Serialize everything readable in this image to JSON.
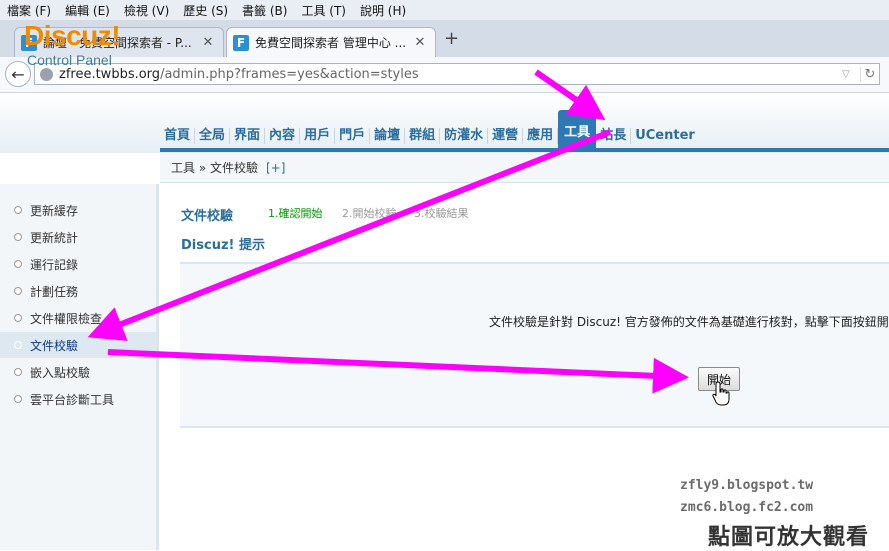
{
  "menubar": [
    "檔案 (F)",
    "編輯 (E)",
    "檢視 (V)",
    "歷史 (S)",
    "書籤 (B)",
    "工具 (T)",
    "說明 (H)"
  ],
  "tabs": [
    {
      "favicon": "F",
      "title": "論壇 - 免費空間探索者 - P..."
    },
    {
      "favicon": "F",
      "title": "免費空間探索者 管理中心 ..."
    }
  ],
  "new_tab": "+",
  "address": {
    "domain": "zfree.twbbs.org",
    "prefix": "",
    "path": "/admin.php?frames=yes&action=styles"
  },
  "logo": {
    "main": "Discuz!",
    "sub": "Control Panel"
  },
  "topnav": [
    "首頁",
    "全局",
    "界面",
    "內容",
    "用戶",
    "門戶",
    "論壇",
    "群組",
    "防灌水",
    "運營",
    "應用",
    "工具",
    "站長",
    "UCenter"
  ],
  "topnav_active": "工具",
  "breadcrumb": {
    "path": "工具 » 文件校驗",
    "add": "[+]"
  },
  "sidebar": [
    {
      "label": "更新緩存"
    },
    {
      "label": "更新統計"
    },
    {
      "label": "運行記錄"
    },
    {
      "label": "計劃任務"
    },
    {
      "label": "文件權限檢查"
    },
    {
      "label": "文件校驗"
    },
    {
      "label": "嵌入點校驗"
    },
    {
      "label": "雲平台診斷工具"
    }
  ],
  "sidebar_active": "文件校驗",
  "content": {
    "title": "文件校驗",
    "steps": [
      "1.確認開始",
      "2.開始校驗",
      "3.校驗結果"
    ],
    "tips_title": "Discuz! 提示",
    "tips_text": "文件校驗是針對 Discuz! 官方發佈的文件為基礎進行核對，點擊下面按鈕開",
    "start_button": "開始"
  },
  "watermark": [
    "zfly9.blogspot.tw",
    "zmc6.blog.fc2.com",
    "點圖可放大觀看"
  ],
  "colors": {
    "accent": "#2e79b3",
    "logo": "#f08a00",
    "arrow": "#ff00ff",
    "step_active": "#009900"
  },
  "icons": [
    "back-arrow-icon",
    "globe-icon",
    "reload-icon",
    "close-icon",
    "hand-cursor-icon"
  ]
}
